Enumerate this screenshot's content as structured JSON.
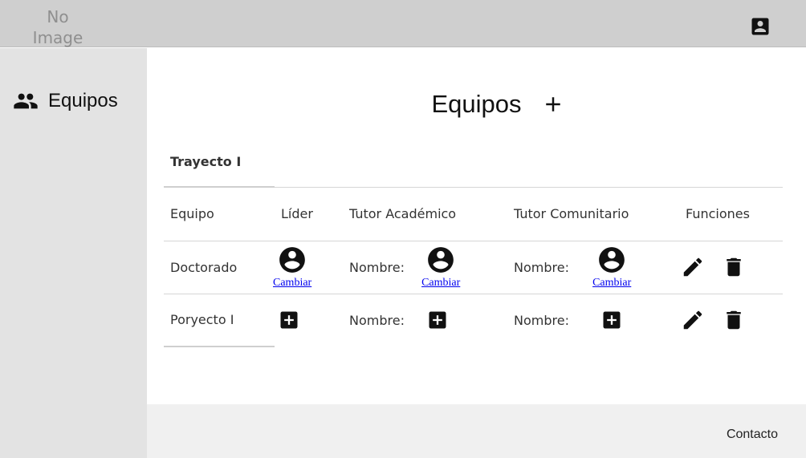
{
  "header": {
    "logo_text": "No Image",
    "account_icon": "account-box-icon"
  },
  "sidebar": {
    "items": [
      {
        "label": "Equipos",
        "icon": "group-icon"
      }
    ]
  },
  "main": {
    "title": "Equipos",
    "add_icon": "plus-icon",
    "tabs": [
      {
        "label": "Trayecto I",
        "active": true
      }
    ],
    "table": {
      "headers": [
        "Equipo",
        "Líder",
        "Tutor Académico",
        "Tutor Comunitario",
        "Funciones"
      ],
      "name_label": "Nombre:",
      "change_label": "Cambiar",
      "rows": [
        {
          "equipo": "Doctorado",
          "assigned": true
        },
        {
          "equipo": "Poryecto I",
          "assigned": false
        }
      ]
    }
  },
  "footer": {
    "contact": "Contacto"
  },
  "colors": {
    "topbar": "#cfcfcf",
    "sidebar": "#e3e3e3",
    "footer": "#f0f0f0",
    "link": "#0000ee"
  }
}
